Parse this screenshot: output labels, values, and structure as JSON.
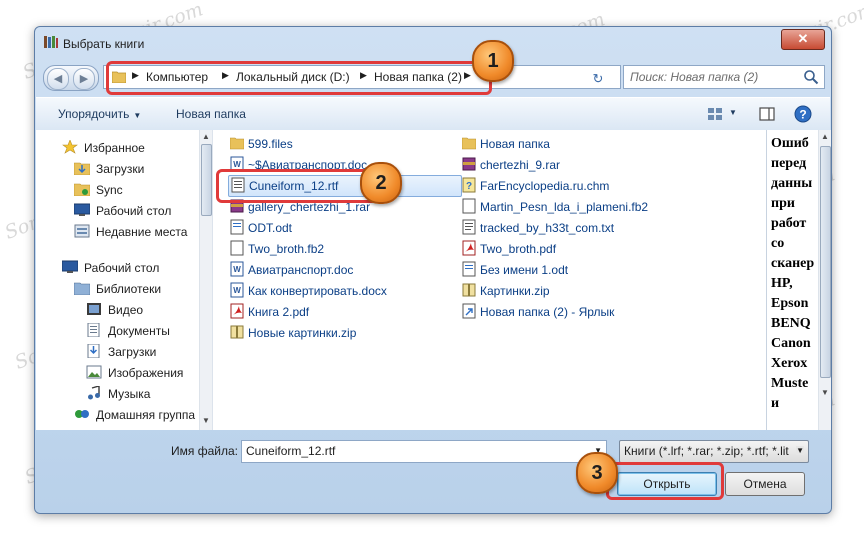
{
  "window": {
    "title": "Выбрать книги",
    "close_label": "✕"
  },
  "address_bar": {
    "crumbs": [
      "Компьютер",
      "Локальный диск (D:)",
      "Новая папка (2)"
    ]
  },
  "search": {
    "placeholder": "Поиск: Новая папка (2)"
  },
  "toolbar": {
    "organize_label": "Упорядочить",
    "new_folder_label": "Новая папка"
  },
  "nav_pane": {
    "favorites_label": "Избранное",
    "favorites": [
      "Загрузки",
      "Sync",
      "Рабочий стол",
      "Недавние места"
    ],
    "desktop_label": "Рабочий стол",
    "libraries_label": "Библиотеки",
    "libraries": [
      "Видео",
      "Документы",
      "Загрузки",
      "Изображения",
      "Музыка"
    ],
    "homegroup_label": "Домашняя группа"
  },
  "files": {
    "col1": [
      "599.files",
      "~$Авиатранспорт.doc",
      "Cuneiform_12.rtf",
      "gallery_chertezhi_1.rar",
      "ODT.odt",
      "Two_broth.fb2",
      "Авиатранспорт.doc",
      "Как конвертировать.docx",
      "Книга 2.pdf",
      "Новые картинки.zip"
    ],
    "col2": [
      "Новая папка",
      "chertezhi_9.rar",
      "FarEncyclopedia.ru.chm",
      "Martin_Pesn_lda_i_plameni.fb2",
      "tracked_by_h33t_com.txt",
      "Two_broth.pdf",
      "Без имени 1.odt",
      "Картинки.zip",
      "Новая папка (2) - Ярлык"
    ]
  },
  "preview": {
    "lines": [
      "Ошиб",
      "перед",
      "данны",
      "при",
      "работ",
      "со",
      "сканер",
      "HP,",
      "Epson",
      "BENQ",
      "Canon",
      "Xerox",
      "Muste",
      "и"
    ]
  },
  "bottom": {
    "filename_label": "Имя файла:",
    "filename_value": "Cuneiform_12.rtf",
    "filter_value": "Книги (*.lrf; *.rar; *.zip; *.rtf; *.lit",
    "open_label": "Открыть",
    "cancel_label": "Отмена"
  },
  "callouts": {
    "one": "1",
    "two": "2",
    "three": "3"
  },
  "watermark": {
    "text": "Soringpcrepair.com"
  },
  "colors": {
    "accent_red": "#e03a3a",
    "badge_orange": "#f08a2a",
    "link_blue": "#0b3f86"
  }
}
